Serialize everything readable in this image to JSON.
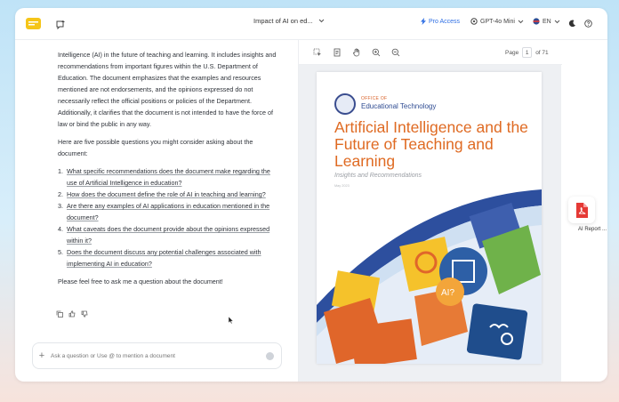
{
  "header": {
    "doc_title": "Impact of AI on ed...",
    "pro_access": "Pro Access",
    "model": "GPT-4o Mini",
    "language": "EN"
  },
  "chat": {
    "intro": "Intelligence (AI) in the future of teaching and learning. It includes insights and recommendations from important figures within the U.S. Department of Education. The document emphasizes that the examples and resources mentioned are not endorsements, and the opinions expressed do not necessarily reflect the official positions or policies of the Department. Additionally, it clarifies that the document is not intended to have the force of law or bind the public in any way.",
    "lead": "Here are five possible questions you might consider asking about the document:",
    "questions": [
      {
        "num": "1.",
        "text": "What specific recommendations does the document make regarding the use of Artificial Intelligence in education?"
      },
      {
        "num": "2.",
        "text": "How does the document define the role of AI in teaching and learning?"
      },
      {
        "num": "3.",
        "text": "Are there any examples of AI applications in education mentioned in the document?"
      },
      {
        "num": "4.",
        "text": "What caveats does the document provide about the opinions expressed within it?"
      },
      {
        "num": "5.",
        "text": "Does the document discuss any potential challenges associated with implementing AI in education?"
      }
    ],
    "closing": "Please feel free to ask me a question about the document!",
    "input_placeholder": "Ask a question or Use @ to mention a document"
  },
  "viewer": {
    "page_label": "Page",
    "page_current": "1",
    "page_total": "of 71",
    "doc": {
      "office_line1": "OFFICE OF",
      "office_line2": "Educational Technology",
      "title": "Artificial Intelligence and the Future of Teaching and Learning",
      "subtitle": "Insights and Recommendations",
      "date": "May 2023",
      "art_text": "AI?"
    }
  },
  "side_doc": {
    "label": "AI Report ..."
  },
  "colors": {
    "accent": "#2f6fe4",
    "title_orange": "#df6a22",
    "pdf_red": "#e53935"
  }
}
